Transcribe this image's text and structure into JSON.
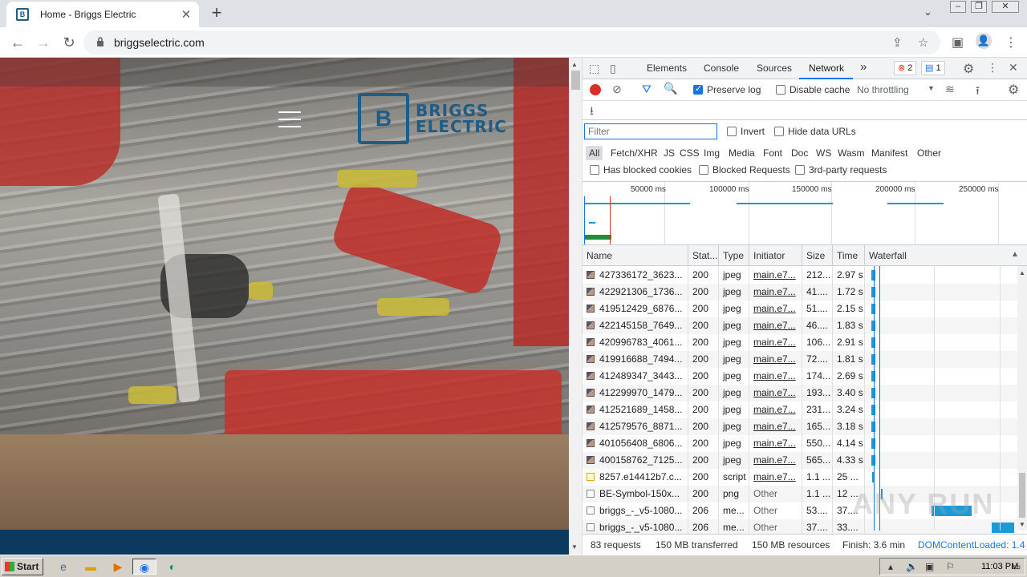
{
  "browser": {
    "tab_title": "Home - Briggs Electric",
    "url": "briggselectric.com",
    "favicon_text": "B"
  },
  "page": {
    "logo_mark": "B",
    "logo_line1": "BRIGGS",
    "logo_line2": "ELECTRIC"
  },
  "devtools": {
    "tabs": [
      "Elements",
      "Console",
      "Sources",
      "Network"
    ],
    "active_tab": "Network",
    "more_tabs": "»",
    "errors_count": "2",
    "messages_count": "1",
    "preserve_log": "Preserve log",
    "disable_cache": "Disable cache",
    "throttling": "No throttling",
    "filter_placeholder": "Filter",
    "invert": "Invert",
    "hide_data_urls": "Hide data URLs",
    "type_filters": [
      "All",
      "Fetch/XHR",
      "JS",
      "CSS",
      "Img",
      "Media",
      "Font",
      "Doc",
      "WS",
      "Wasm",
      "Manifest",
      "Other"
    ],
    "has_blocked_cookies": "Has blocked cookies",
    "blocked_requests": "Blocked Requests",
    "third_party": "3rd-party requests",
    "overview_ticks": [
      "50000 ms",
      "100000 ms",
      "150000 ms",
      "200000 ms",
      "250000 ms"
    ],
    "columns": [
      "Name",
      "Stat...",
      "Type",
      "Initiator",
      "Size",
      "Time",
      "Waterfall"
    ],
    "rows": [
      {
        "name": "427336172_3623...",
        "status": "200",
        "type": "jpeg",
        "initiator": "main.e7...",
        "size": "212...",
        "time": "2.97 s",
        "icon": "img"
      },
      {
        "name": "422921306_1736...",
        "status": "200",
        "type": "jpeg",
        "initiator": "main.e7...",
        "size": "41....",
        "time": "1.72 s",
        "icon": "img"
      },
      {
        "name": "419512429_6876...",
        "status": "200",
        "type": "jpeg",
        "initiator": "main.e7...",
        "size": "51....",
        "time": "2.15 s",
        "icon": "img"
      },
      {
        "name": "422145158_7649...",
        "status": "200",
        "type": "jpeg",
        "initiator": "main.e7...",
        "size": "46....",
        "time": "1.83 s",
        "icon": "img"
      },
      {
        "name": "420996783_4061...",
        "status": "200",
        "type": "jpeg",
        "initiator": "main.e7...",
        "size": "106...",
        "time": "2.91 s",
        "icon": "img"
      },
      {
        "name": "419916688_7494...",
        "status": "200",
        "type": "jpeg",
        "initiator": "main.e7...",
        "size": "72....",
        "time": "1.81 s",
        "icon": "img"
      },
      {
        "name": "412489347_3443...",
        "status": "200",
        "type": "jpeg",
        "initiator": "main.e7...",
        "size": "174...",
        "time": "2.69 s",
        "icon": "img"
      },
      {
        "name": "412299970_1479...",
        "status": "200",
        "type": "jpeg",
        "initiator": "main.e7...",
        "size": "193...",
        "time": "3.40 s",
        "icon": "img"
      },
      {
        "name": "412521689_1458...",
        "status": "200",
        "type": "jpeg",
        "initiator": "main.e7...",
        "size": "231...",
        "time": "3.24 s",
        "icon": "img"
      },
      {
        "name": "412579576_8871...",
        "status": "200",
        "type": "jpeg",
        "initiator": "main.e7...",
        "size": "165...",
        "time": "3.18 s",
        "icon": "img"
      },
      {
        "name": "401056408_6806...",
        "status": "200",
        "type": "jpeg",
        "initiator": "main.e7...",
        "size": "550...",
        "time": "4.14 s",
        "icon": "img"
      },
      {
        "name": "400158762_7125...",
        "status": "200",
        "type": "jpeg",
        "initiator": "main.e7...",
        "size": "565...",
        "time": "4.33 s",
        "icon": "img"
      },
      {
        "name": "8257.e14412b7.c...",
        "status": "200",
        "type": "script",
        "initiator": "main.e7...",
        "size": "1.1 ...",
        "time": "25 ...",
        "icon": "js"
      },
      {
        "name": "BE-Symbol-150x...",
        "status": "200",
        "type": "png",
        "initiator": "Other",
        "size": "1.1 ...",
        "time": "12 ...",
        "icon": "doc"
      },
      {
        "name": "briggs_-_v5-1080...",
        "status": "206",
        "type": "me...",
        "initiator": "Other",
        "size": "53....",
        "time": "37....",
        "icon": "doc"
      },
      {
        "name": "briggs_-_v5-1080...",
        "status": "206",
        "type": "me...",
        "initiator": "Other",
        "size": "37....",
        "time": "33....",
        "icon": "doc"
      }
    ],
    "status": {
      "requests": "83 requests",
      "transferred": "150 MB transferred",
      "resources": "150 MB resources",
      "finish": "Finish: 3.6 min",
      "dcl": "DOMContentLoaded: 1.4"
    }
  },
  "taskbar": {
    "start": "Start",
    "clock": "11:03 PM"
  },
  "watermark": "ANY RUN",
  "colors": {
    "accent": "#1a73e8",
    "brand": "#1f5c86",
    "record": "#d93025"
  }
}
